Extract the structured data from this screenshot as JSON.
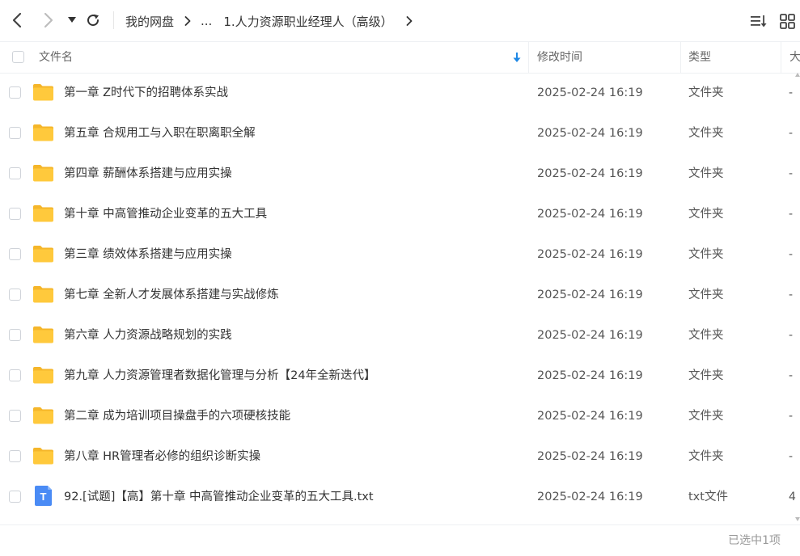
{
  "toolbar": {
    "back_icon": "chevron-left-icon",
    "forward_icon": "chevron-right-icon",
    "history_icon": "caret-down-icon",
    "refresh_icon": "refresh-icon",
    "sort_icon": "sort-list-icon",
    "view_icon": "grid-view-icon"
  },
  "breadcrumb": {
    "root": "我的网盘",
    "ellipsis": "...",
    "current": "1.人力资源职业经理人（高级）"
  },
  "columns": {
    "name": "文件名",
    "modified": "修改时间",
    "type": "类型",
    "size": "大"
  },
  "files": [
    {
      "name": "第一章 Z时代下的招聘体系实战",
      "time": "2025-02-24 16:19",
      "type": "文件夹",
      "size": "-",
      "icon": "folder-icon"
    },
    {
      "name": "第五章 合规用工与入职在职离职全解",
      "time": "2025-02-24 16:19",
      "type": "文件夹",
      "size": "-",
      "icon": "folder-icon"
    },
    {
      "name": "第四章 薪酬体系搭建与应用实操",
      "time": "2025-02-24 16:19",
      "type": "文件夹",
      "size": "-",
      "icon": "folder-icon"
    },
    {
      "name": "第十章 中高管推动企业变革的五大工具",
      "time": "2025-02-24 16:19",
      "type": "文件夹",
      "size": "-",
      "icon": "folder-icon"
    },
    {
      "name": "第三章 绩效体系搭建与应用实操",
      "time": "2025-02-24 16:19",
      "type": "文件夹",
      "size": "-",
      "icon": "folder-icon"
    },
    {
      "name": "第七章 全新人才发展体系搭建与实战修炼",
      "time": "2025-02-24 16:19",
      "type": "文件夹",
      "size": "-",
      "icon": "folder-icon"
    },
    {
      "name": "第六章 人力资源战略规划的实践",
      "time": "2025-02-24 16:19",
      "type": "文件夹",
      "size": "-",
      "icon": "folder-icon"
    },
    {
      "name": "第九章 人力资源管理者数据化管理与分析【24年全新迭代】",
      "time": "2025-02-24 16:19",
      "type": "文件夹",
      "size": "-",
      "icon": "folder-icon"
    },
    {
      "name": "第二章 成为培训项目操盘手的六项硬核技能",
      "time": "2025-02-24 16:19",
      "type": "文件夹",
      "size": "-",
      "icon": "folder-icon"
    },
    {
      "name": "第八章 HR管理者必修的组织诊断实操",
      "time": "2025-02-24 16:19",
      "type": "文件夹",
      "size": "-",
      "icon": "folder-icon"
    },
    {
      "name": "92.[试题]【高】第十章  中高管推动企业变革的五大工具.txt",
      "time": "2025-02-24 16:19",
      "type": "txt文件",
      "size": "4",
      "icon": "txt-file-icon",
      "icon_letter": "T"
    }
  ],
  "status": {
    "selection": "已选中1项"
  },
  "colors": {
    "folder": "#FFC93C",
    "folder_tab": "#F5B62A",
    "txt_icon": "#4A8BF5",
    "sort_accent": "#1E88E5"
  }
}
